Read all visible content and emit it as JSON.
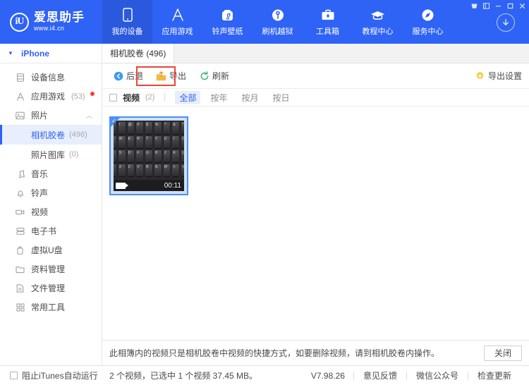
{
  "brand": {
    "name": "爱思助手",
    "url": "www.i4.cn",
    "logo_glyph": "iU"
  },
  "topnav": {
    "items": [
      {
        "label": "我的设备",
        "icon": "phone-icon",
        "active": true
      },
      {
        "label": "应用游戏",
        "icon": "apps-icon",
        "active": false
      },
      {
        "label": "铃声壁纸",
        "icon": "ringtone-icon",
        "active": false
      },
      {
        "label": "刷机越狱",
        "icon": "flash-icon",
        "active": false
      },
      {
        "label": "工具箱",
        "icon": "toolbox-icon",
        "active": false
      },
      {
        "label": "教程中心",
        "icon": "graduation-icon",
        "active": false
      },
      {
        "label": "服务中心",
        "icon": "compass-icon",
        "active": false
      }
    ],
    "window_controls": [
      "skin-icon",
      "menu-icon",
      "minimize-icon",
      "maximize-icon",
      "close-icon"
    ],
    "download_button": "download-icon"
  },
  "sidebar": {
    "device": "iPhone",
    "items": [
      {
        "label": "设备信息",
        "icon": "device-info-icon",
        "count": "",
        "badge": false
      },
      {
        "label": "应用游戏",
        "icon": "apps-icon",
        "count": "(53)",
        "badge": true
      },
      {
        "label": "照片",
        "icon": "photo-icon",
        "count": "",
        "badge": false,
        "expanded": true
      }
    ],
    "photo_children": [
      {
        "label": "相机胶卷",
        "count": "(496)",
        "selected": true
      },
      {
        "label": "照片图库",
        "count": "(0)",
        "selected": false
      }
    ],
    "items_after": [
      {
        "label": "音乐",
        "icon": "music-icon"
      },
      {
        "label": "铃声",
        "icon": "bell-icon"
      },
      {
        "label": "视频",
        "icon": "video-icon"
      },
      {
        "label": "电子书",
        "icon": "book-icon"
      },
      {
        "label": "虚拟U盘",
        "icon": "usb-icon"
      },
      {
        "label": "资料管理",
        "icon": "folder-icon"
      },
      {
        "label": "文件管理",
        "icon": "file-icon"
      },
      {
        "label": "常用工具",
        "icon": "grid-icon"
      }
    ]
  },
  "main": {
    "tab_label": "相机胶卷 (496)",
    "toolbar": {
      "back_label": "后退",
      "export_label": "导出",
      "refresh_label": "刷新",
      "export_settings_label": "导出设置",
      "highlight_color": "#e8453c"
    },
    "filterbar": {
      "title": "视频",
      "count": "(2)",
      "chips": [
        {
          "label": "全部",
          "active": true
        },
        {
          "label": "按年",
          "active": false
        },
        {
          "label": "按月",
          "active": false
        },
        {
          "label": "按日",
          "active": false
        }
      ]
    },
    "items": [
      {
        "duration": "00:11",
        "selected": true,
        "type": "video"
      }
    ]
  },
  "notice": {
    "text": "此相簿内的视频只是相机胶卷中视频的快捷方式，如要删除视频，请到相机胶卷内操作。",
    "close_label": "关闭"
  },
  "statusbar": {
    "itunes_checkbox_label": "阻止iTunes自动运行",
    "summary": "2 个视频，已选中 1 个视频 37.45 MB。",
    "version": "V7.98.26",
    "links": [
      "意见反馈",
      "微信公众号",
      "检查更新"
    ]
  },
  "colors": {
    "brand_blue": "#2f63f5",
    "nav_active": "#2a59de",
    "selection_bg": "#e8eefc",
    "highlight_red": "#e8453c",
    "badge_red": "#ff3b30"
  }
}
